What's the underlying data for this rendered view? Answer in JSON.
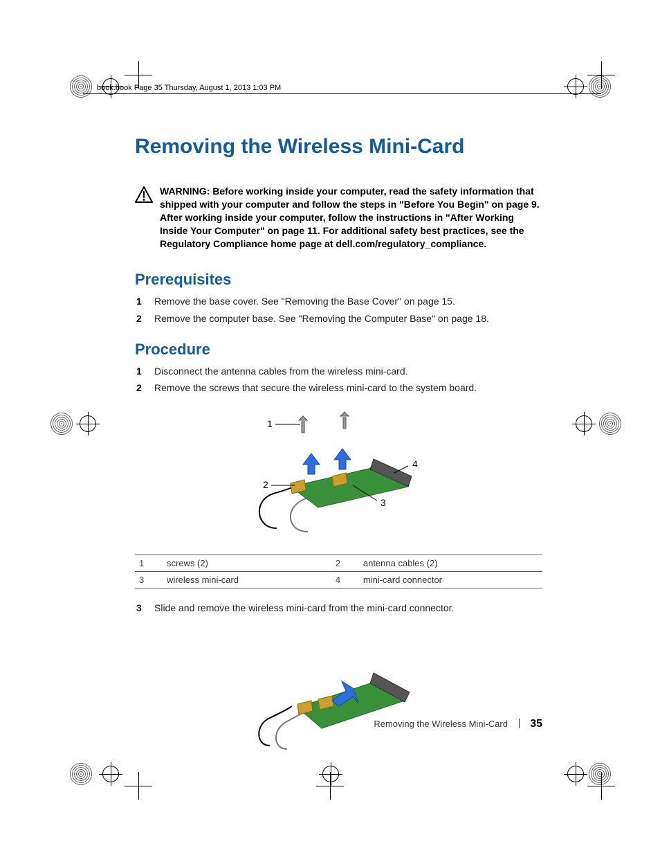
{
  "header": {
    "running_head": "book.book  Page 35  Thursday, August 1, 2013  1:03 PM"
  },
  "title": "Removing the Wireless Mini-Card",
  "warning": {
    "label": "WARNING:",
    "text": "Before working inside your computer, read the safety information that shipped with your computer and follow the steps in \"Before You Begin\" on page 9. After working inside your computer, follow the instructions in \"After Working Inside Your Computer\" on page 11. For additional safety best practices, see the Regulatory Compliance home page at dell.com/regulatory_compliance."
  },
  "sections": {
    "prerequisites": {
      "heading": "Prerequisites",
      "steps": [
        "Remove the base cover. See \"Removing the Base Cover\" on page 15.",
        "Remove the computer base. See \"Removing the Computer Base\" on page 18."
      ]
    },
    "procedure": {
      "heading": "Procedure",
      "steps": [
        "Disconnect the antenna cables from the wireless mini-card.",
        "Remove the screws that secure the wireless mini-card to the system board."
      ],
      "step3_num": "3",
      "step3_text": "Slide and remove the wireless mini-card from the mini-card connector."
    }
  },
  "figure1": {
    "labels": {
      "1": "1",
      "2": "2",
      "3": "3",
      "4": "4"
    }
  },
  "callout_table": {
    "rows": [
      {
        "n1": "1",
        "t1": "screws (2)",
        "n2": "2",
        "t2": "antenna cables (2)"
      },
      {
        "n1": "3",
        "t1": "wireless mini-card",
        "n2": "4",
        "t2": "mini-card connector"
      }
    ]
  },
  "footer": {
    "chapter": "Removing the Wireless Mini-Card",
    "page_number": "35"
  }
}
